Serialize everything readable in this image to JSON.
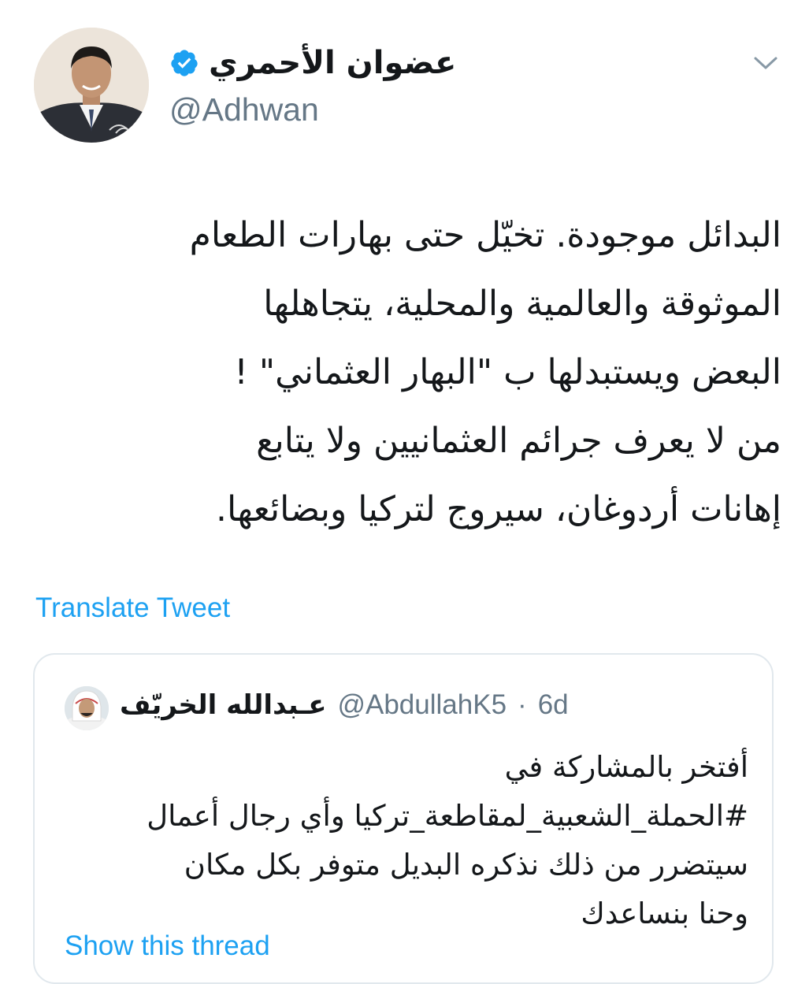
{
  "author": {
    "display_name": "عضوان الأحمري",
    "handle": "@Adhwan",
    "verified": true
  },
  "icons": {
    "verified": "verified-badge-icon",
    "menu": "chevron-down-icon"
  },
  "tweet": {
    "lines": [
      "البدائل موجودة. تخيّل حتى بهارات الطعام",
      "الموثوقة والعالمية والمحلية، يتجاهلها",
      "البعض ويستبدلها ب \"البهار العثماني\" !",
      "من لا يعرف جرائم العثمانيين ولا يتابع",
      "إهانات أردوغان، سيروج لتركيا وبضائعها."
    ],
    "translate_label": "Translate Tweet"
  },
  "quoted": {
    "display_name": "عـبدالله الخريّف",
    "handle": "@AbdullahK5",
    "separator": "·",
    "time": "6d",
    "lines": [
      "أفتخر بالمشاركة في",
      "#الحملة_الشعبية_لمقاطعة_تركيا وأي رجال أعمال",
      "سيتضرر من ذلك نذكره البديل متوفر بكل مكان",
      "وحنا بنساعدك"
    ],
    "show_thread_label": "Show this thread"
  },
  "colors": {
    "accent": "#1da1f2",
    "text": "#14171a",
    "secondary": "#657786",
    "border": "#e1e8ed"
  }
}
